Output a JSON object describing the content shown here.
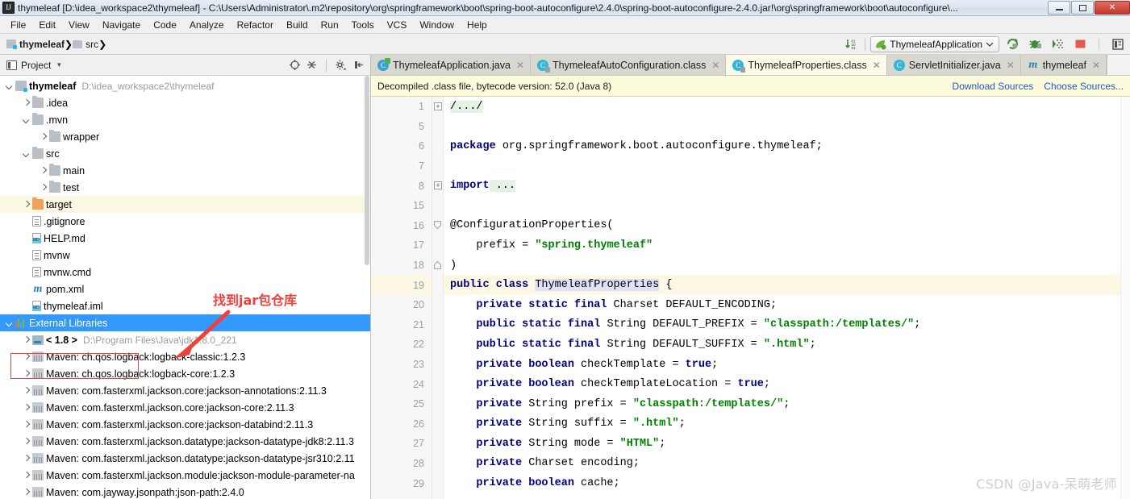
{
  "window": {
    "title": "thymeleaf [D:\\idea_workspace2\\thymeleaf] - C:\\Users\\Administrator\\.m2\\repository\\org\\springframework\\boot\\spring-boot-autoconfigure\\2.4.0\\spring-boot-autoconfigure-2.4.0.jar!\\org\\springframework\\boot\\autoconfigure\\...",
    "app_icon": "intellij-idea-icon",
    "minimize_label": "Minimize",
    "maximize_label": "Restore",
    "close_label": "Close"
  },
  "menubar": {
    "items": [
      "File",
      "Edit",
      "View",
      "Navigate",
      "Code",
      "Analyze",
      "Refactor",
      "Build",
      "Run",
      "Tools",
      "VCS",
      "Window",
      "Help"
    ]
  },
  "navbar": {
    "breadcrumbs": [
      {
        "label": "thymeleaf",
        "icon": "module-icon",
        "bold": true
      },
      {
        "label": "src",
        "icon": "folder-icon",
        "bold": false
      }
    ],
    "sort_icon": "sort-numeric-icon",
    "run_configuration": "ThymeleafApplication",
    "run_config_icon": "spring-leaf-icon",
    "dropdown_icon": "chevron-down-icon",
    "actions": [
      {
        "name": "run-button",
        "icon": "run-green-arrow-icon"
      },
      {
        "name": "debug-button",
        "icon": "debug-bug-icon"
      },
      {
        "name": "run-with-coverage-button",
        "icon": "coverage-icon"
      },
      {
        "name": "stop-button",
        "icon": "stop-square-icon"
      },
      {
        "name": "more-button",
        "icon": "layout-icon"
      }
    ]
  },
  "project_panel": {
    "header_title": "Project",
    "header_icon": "project-view-icon",
    "header_caret": "chevron-down-icon",
    "toolbar_icons": [
      "locate-target-icon",
      "collapse-all-icon",
      "settings-gear-icon",
      "hide-panel-icon"
    ],
    "tree": [
      {
        "indent": 0,
        "arrow": "down",
        "icon": "module-icon",
        "label": "thymeleaf",
        "bold": true,
        "path": "D:\\idea_workspace2\\thymeleaf",
        "state": "normal"
      },
      {
        "indent": 1,
        "arrow": "right",
        "icon": "folder-icon",
        "label": ".idea",
        "bold": false,
        "path": "",
        "state": "normal"
      },
      {
        "indent": 1,
        "arrow": "down",
        "icon": "folder-icon",
        "label": ".mvn",
        "bold": false,
        "path": "",
        "state": "normal"
      },
      {
        "indent": 2,
        "arrow": "right",
        "icon": "folder-icon",
        "label": "wrapper",
        "bold": false,
        "path": "",
        "state": "normal"
      },
      {
        "indent": 1,
        "arrow": "down",
        "icon": "folder-icon",
        "label": "src",
        "bold": false,
        "path": "",
        "state": "normal"
      },
      {
        "indent": 2,
        "arrow": "right",
        "icon": "folder-icon",
        "label": "main",
        "bold": false,
        "path": "",
        "state": "normal"
      },
      {
        "indent": 2,
        "arrow": "right",
        "icon": "folder-icon",
        "label": "test",
        "bold": false,
        "path": "",
        "state": "normal"
      },
      {
        "indent": 1,
        "arrow": "right",
        "icon": "folder-orange-icon",
        "label": "target",
        "bold": false,
        "path": "",
        "state": "highlight"
      },
      {
        "indent": 1,
        "arrow": "none",
        "icon": "file-icon",
        "label": ".gitignore",
        "bold": false,
        "path": "",
        "state": "normal"
      },
      {
        "indent": 1,
        "arrow": "none",
        "icon": "markdown-icon",
        "label": "HELP.md",
        "bold": false,
        "path": "",
        "state": "normal"
      },
      {
        "indent": 1,
        "arrow": "none",
        "icon": "file-icon",
        "label": "mvnw",
        "bold": false,
        "path": "",
        "state": "normal"
      },
      {
        "indent": 1,
        "arrow": "none",
        "icon": "file-icon",
        "label": "mvnw.cmd",
        "bold": false,
        "path": "",
        "state": "normal"
      },
      {
        "indent": 1,
        "arrow": "none",
        "icon": "maven-icon",
        "label": "pom.xml",
        "bold": false,
        "path": "",
        "state": "normal"
      },
      {
        "indent": 1,
        "arrow": "none",
        "icon": "iml-icon",
        "label": "thymeleaf.iml",
        "bold": false,
        "path": "",
        "state": "normal"
      },
      {
        "indent": 0,
        "arrow": "down",
        "icon": "library-icon",
        "label": "External Libraries",
        "bold": false,
        "path": "",
        "state": "selected"
      },
      {
        "indent": 1,
        "arrow": "right",
        "icon": "jdk-icon",
        "label": "< 1.8 >",
        "bold": true,
        "path": "D:\\Program Files\\Java\\jdk1.8.0_221",
        "state": "normal"
      },
      {
        "indent": 1,
        "arrow": "right",
        "icon": "jar-icon",
        "label": "Maven: ch.qos.logback:logback-classic:1.2.3",
        "bold": false,
        "path": "",
        "state": "normal"
      },
      {
        "indent": 1,
        "arrow": "right",
        "icon": "jar-icon",
        "label": "Maven: ch.qos.logback:logback-core:1.2.3",
        "bold": false,
        "path": "",
        "state": "normal"
      },
      {
        "indent": 1,
        "arrow": "right",
        "icon": "jar-icon",
        "label": "Maven: com.fasterxml.jackson.core:jackson-annotations:2.11.3",
        "bold": false,
        "path": "",
        "state": "normal"
      },
      {
        "indent": 1,
        "arrow": "right",
        "icon": "jar-icon",
        "label": "Maven: com.fasterxml.jackson.core:jackson-core:2.11.3",
        "bold": false,
        "path": "",
        "state": "normal"
      },
      {
        "indent": 1,
        "arrow": "right",
        "icon": "jar-icon",
        "label": "Maven: com.fasterxml.jackson.core:jackson-databind:2.11.3",
        "bold": false,
        "path": "",
        "state": "normal"
      },
      {
        "indent": 1,
        "arrow": "right",
        "icon": "jar-icon",
        "label": "Maven: com.fasterxml.jackson.datatype:jackson-datatype-jdk8:2.11.3",
        "bold": false,
        "path": "",
        "state": "normal"
      },
      {
        "indent": 1,
        "arrow": "right",
        "icon": "jar-icon",
        "label": "Maven: com.fasterxml.jackson.datatype:jackson-datatype-jsr310:2.11",
        "bold": false,
        "path": "",
        "state": "normal"
      },
      {
        "indent": 1,
        "arrow": "right",
        "icon": "jar-icon",
        "label": "Maven: com.fasterxml.jackson.module:jackson-module-parameter-na",
        "bold": false,
        "path": "",
        "state": "normal"
      },
      {
        "indent": 1,
        "arrow": "right",
        "icon": "jar-icon",
        "label": "Maven: com.jayway.jsonpath:json-path:2.4.0",
        "bold": false,
        "path": "",
        "state": "normal"
      }
    ]
  },
  "annotation": {
    "text": "找到jar包仓库",
    "color": "#f0403a",
    "box_target": "External Libraries"
  },
  "editor_tabs": [
    {
      "label": "ThymeleafApplication.java",
      "icon": "java-class-run-icon",
      "active": false,
      "close_icon": "close-icon"
    },
    {
      "label": "ThymeleafAutoConfiguration.class",
      "icon": "compiled-class-icon",
      "active": false,
      "close_icon": "close-icon"
    },
    {
      "label": "ThymeleafProperties.class",
      "icon": "compiled-class-icon",
      "active": true,
      "close_icon": "close-icon"
    },
    {
      "label": "ServletInitializer.java",
      "icon": "java-class-icon",
      "active": false,
      "close_icon": "close-icon"
    },
    {
      "label": "thymeleaf",
      "icon": "maven-icon",
      "active": false,
      "close_icon": "close-icon"
    }
  ],
  "notice": {
    "message": "Decompiled .class file, bytecode version: 52.0 (Java 8)",
    "links": [
      "Download Sources",
      "Choose Sources..."
    ]
  },
  "editor": {
    "current_line": 19,
    "lines": [
      {
        "num": "1",
        "fold": "plus",
        "current": false,
        "tokens": [
          {
            "t": "fold",
            "v": "/.../"
          }
        ]
      },
      {
        "num": "5",
        "fold": "",
        "current": false,
        "tokens": []
      },
      {
        "num": "6",
        "fold": "",
        "current": false,
        "tokens": [
          {
            "t": "kw",
            "v": "package"
          },
          {
            "t": "pl",
            "v": " org.springframework.boot.autoconfigure.thymeleaf;"
          }
        ]
      },
      {
        "num": "7",
        "fold": "",
        "current": false,
        "tokens": []
      },
      {
        "num": "8",
        "fold": "plus",
        "current": false,
        "tokens": [
          {
            "t": "kw",
            "v": "import"
          },
          {
            "t": "fold",
            "v": " ..."
          }
        ]
      },
      {
        "num": "15",
        "fold": "",
        "current": false,
        "tokens": []
      },
      {
        "num": "16",
        "fold": "down",
        "current": false,
        "tokens": [
          {
            "t": "pl",
            "v": "@ConfigurationProperties("
          }
        ]
      },
      {
        "num": "17",
        "fold": "",
        "current": false,
        "tokens": [
          {
            "t": "pl",
            "v": "    prefix = "
          },
          {
            "t": "str",
            "v": "\"spring.thymeleaf\""
          }
        ]
      },
      {
        "num": "18",
        "fold": "up",
        "current": false,
        "tokens": [
          {
            "t": "pl",
            "v": ")"
          }
        ]
      },
      {
        "num": "19",
        "fold": "",
        "current": true,
        "gutter_icon": "spring-bean-icon",
        "tokens": [
          {
            "t": "kw",
            "v": "public class "
          },
          {
            "t": "clshl",
            "v": "ThymeleafProperties"
          },
          {
            "t": "pl",
            "v": " {"
          }
        ]
      },
      {
        "num": "20",
        "fold": "",
        "current": false,
        "tokens": [
          {
            "t": "kw",
            "v": "    private static final "
          },
          {
            "t": "pl",
            "v": "Charset DEFAULT_ENCODING;"
          }
        ]
      },
      {
        "num": "21",
        "fold": "",
        "current": false,
        "tokens": [
          {
            "t": "kw",
            "v": "    public static final "
          },
          {
            "t": "pl",
            "v": "String DEFAULT_PREFIX = "
          },
          {
            "t": "str",
            "v": "\"classpath:/templates/\""
          },
          {
            "t": "pl",
            "v": ";"
          }
        ]
      },
      {
        "num": "22",
        "fold": "",
        "current": false,
        "tokens": [
          {
            "t": "kw",
            "v": "    public static final "
          },
          {
            "t": "pl",
            "v": "String DEFAULT_SUFFIX = "
          },
          {
            "t": "str",
            "v": "\".html\""
          },
          {
            "t": "pl",
            "v": ";"
          }
        ]
      },
      {
        "num": "23",
        "fold": "",
        "current": false,
        "tokens": [
          {
            "t": "kw",
            "v": "    private boolean "
          },
          {
            "t": "pl",
            "v": "checkTemplate = "
          },
          {
            "t": "kw",
            "v": "true"
          },
          {
            "t": "pl",
            "v": ";"
          }
        ]
      },
      {
        "num": "24",
        "fold": "",
        "current": false,
        "tokens": [
          {
            "t": "kw",
            "v": "    private boolean "
          },
          {
            "t": "pl",
            "v": "checkTemplateLocation = "
          },
          {
            "t": "kw",
            "v": "true"
          },
          {
            "t": "pl",
            "v": ";"
          }
        ]
      },
      {
        "num": "25",
        "fold": "",
        "current": false,
        "tokens": [
          {
            "t": "kw",
            "v": "    private "
          },
          {
            "t": "pl",
            "v": "String prefix = "
          },
          {
            "t": "str",
            "v": "\"classpath:/templates/\""
          },
          {
            "t": "pl",
            "v": ";"
          }
        ]
      },
      {
        "num": "26",
        "fold": "",
        "current": false,
        "tokens": [
          {
            "t": "kw",
            "v": "    private "
          },
          {
            "t": "pl",
            "v": "String suffix = "
          },
          {
            "t": "str",
            "v": "\".html\""
          },
          {
            "t": "pl",
            "v": ";"
          }
        ]
      },
      {
        "num": "27",
        "fold": "",
        "current": false,
        "tokens": [
          {
            "t": "kw",
            "v": "    private "
          },
          {
            "t": "pl",
            "v": "String mode = "
          },
          {
            "t": "str",
            "v": "\"HTML\""
          },
          {
            "t": "pl",
            "v": ";"
          }
        ]
      },
      {
        "num": "28",
        "fold": "",
        "current": false,
        "tokens": [
          {
            "t": "kw",
            "v": "    private "
          },
          {
            "t": "pl",
            "v": "Charset encoding;"
          }
        ]
      },
      {
        "num": "29",
        "fold": "",
        "current": false,
        "tokens": [
          {
            "t": "kw",
            "v": "    private boolean "
          },
          {
            "t": "pl",
            "v": "cache;"
          }
        ]
      }
    ]
  },
  "watermark": "CSDN @Java-呆萌老师"
}
